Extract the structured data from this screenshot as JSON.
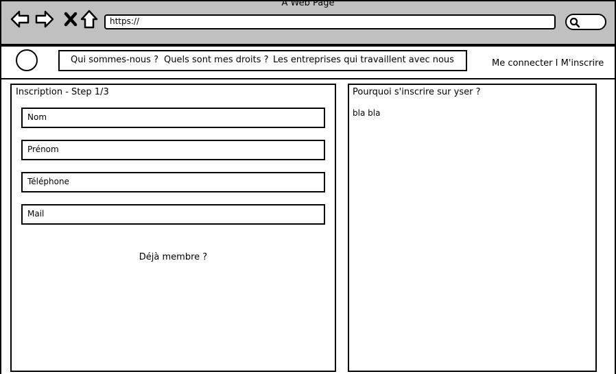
{
  "browser": {
    "window_title": "A Web Page",
    "url": "https://",
    "nav_icons": [
      "back-arrow-icon",
      "forward-arrow-icon",
      "close-x-icon",
      "home-icon"
    ],
    "search_icon": "search-icon"
  },
  "header": {
    "menu": [
      {
        "label": "Qui sommes-nous ?"
      },
      {
        "label": "Quels sont mes droits ?"
      },
      {
        "label": "Les entreprises qui travaillent avec nous"
      }
    ],
    "login_label": "Me connecter",
    "separator": "I",
    "signup_label": "M'inscrire"
  },
  "form": {
    "title": "Inscription - Step 1/3",
    "fields": [
      {
        "placeholder": "Nom"
      },
      {
        "placeholder": "Prénom"
      },
      {
        "placeholder": "Téléphone"
      },
      {
        "placeholder": "Mail"
      }
    ],
    "already_member": "Déjà membre ?"
  },
  "why": {
    "title": "Pourquoi s'inscrire sur yser ?",
    "body": "bla bla"
  }
}
